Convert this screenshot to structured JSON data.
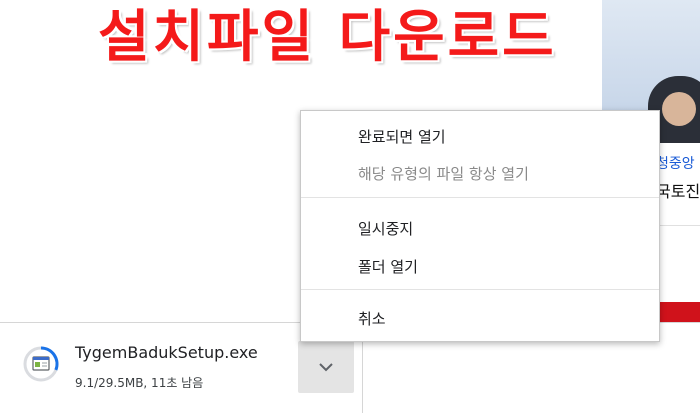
{
  "overlay": {
    "title": "설치파일 다운로드"
  },
  "webpage": {
    "news_title": "청중앙",
    "news_sub": "국토진"
  },
  "context_menu": {
    "items": [
      {
        "label": "완료되면 열기",
        "enabled": true
      },
      {
        "label": "해당 유형의 파일 항상 열기",
        "enabled": false
      },
      {
        "label": "일시중지",
        "enabled": true
      },
      {
        "label": "폴더 열기",
        "enabled": true
      },
      {
        "label": "취소",
        "enabled": true
      }
    ]
  },
  "download": {
    "file_name": "TygemBadukSetup.exe",
    "status": "9.1/29.5MB, 11초 남음",
    "progress": 0.31,
    "icon": "installer-file-icon",
    "menu_icon": "chevron-down-icon"
  },
  "colors": {
    "title_red": "#f41a1a",
    "progress_blue": "#1a73e8",
    "chevron_bg": "#e4e4e4"
  }
}
